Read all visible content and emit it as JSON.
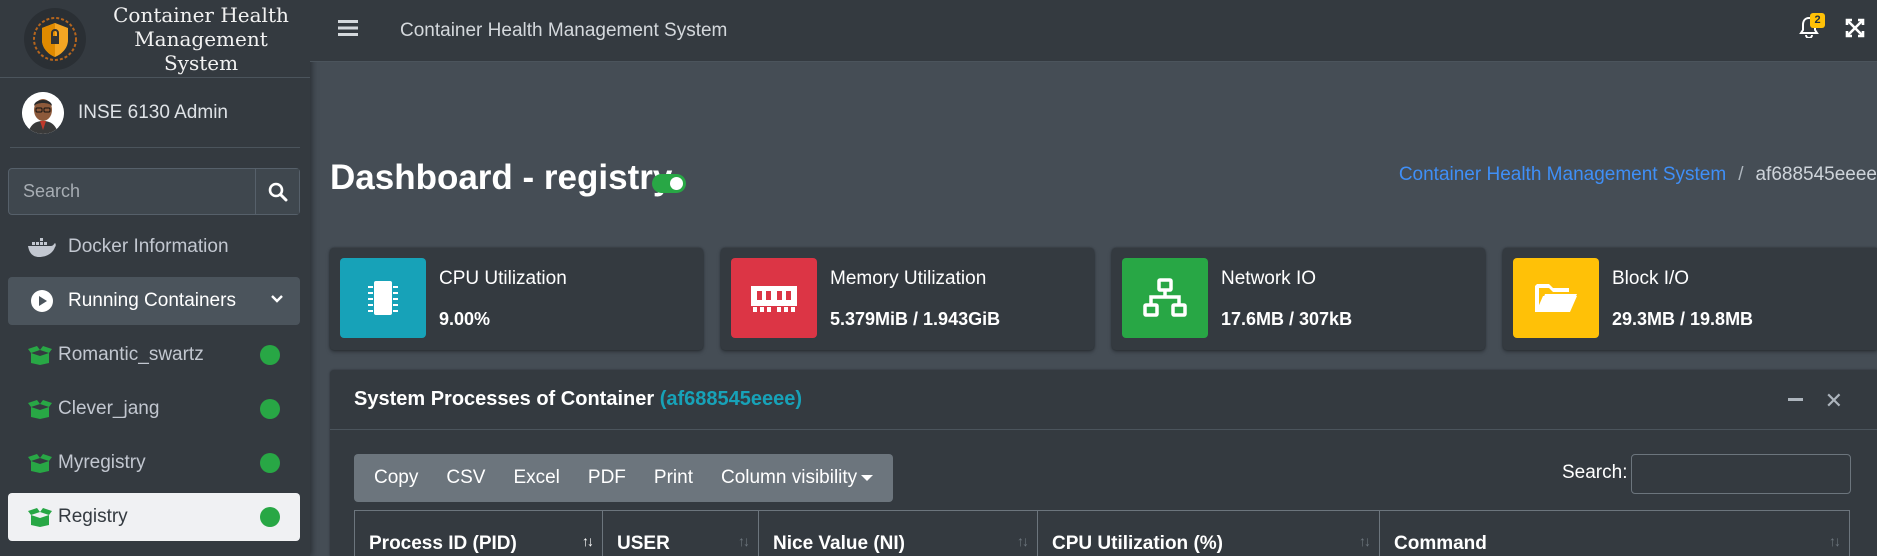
{
  "brand": {
    "title_line1": "Container Health",
    "title_line2": "Management System",
    "logo_icon": "shield-logo-icon"
  },
  "user": {
    "name": "INSE 6130 Admin",
    "avatar_icon": "user-avatar-icon"
  },
  "sidebar": {
    "search_placeholder": "Search",
    "items": [
      {
        "label": "Docker Information",
        "icon": "docker-icon"
      },
      {
        "label": "Running Containers",
        "icon": "play-circle-icon",
        "open": true
      },
      {
        "label": "Romantic_swartz",
        "icon": "box-open-icon",
        "status": "running"
      },
      {
        "label": "Clever_jang",
        "icon": "box-open-icon",
        "status": "running"
      },
      {
        "label": "Myregistry",
        "icon": "box-open-icon",
        "status": "running"
      },
      {
        "label": "Registry",
        "icon": "box-open-icon",
        "status": "running",
        "active": true
      }
    ]
  },
  "topbar": {
    "title": "Container Health Management System",
    "notification_count": "2"
  },
  "header": {
    "title": "Dashboard - registry",
    "breadcrumb_link": "Container Health Management System",
    "breadcrumb_current": "af688545eeee"
  },
  "info_boxes": [
    {
      "label": "CPU Utilization",
      "value": "9.00%",
      "icon": "microchip-icon",
      "color": "#17a2b8"
    },
    {
      "label": "Memory Utilization",
      "value": "5.379MiB / 1.943GiB",
      "icon": "memory-icon",
      "color": "#dc3545"
    },
    {
      "label": "Network IO",
      "value": "17.6MB / 307kB",
      "icon": "network-wired-icon",
      "color": "#28a745"
    },
    {
      "label": "Block I/O",
      "value": "29.3MB / 19.8MB",
      "icon": "folder-open-icon",
      "color": "#ffc107"
    }
  ],
  "processes_card": {
    "title": "System Processes of Container",
    "container_id": "(af688545eeee)",
    "buttons": [
      "Copy",
      "CSV",
      "Excel",
      "PDF",
      "Print",
      "Column visibility"
    ],
    "search_label": "Search:",
    "columns": [
      "Process ID (PID)",
      "USER",
      "Nice Value (NI)",
      "CPU Utilization (%)",
      "Command"
    ]
  }
}
